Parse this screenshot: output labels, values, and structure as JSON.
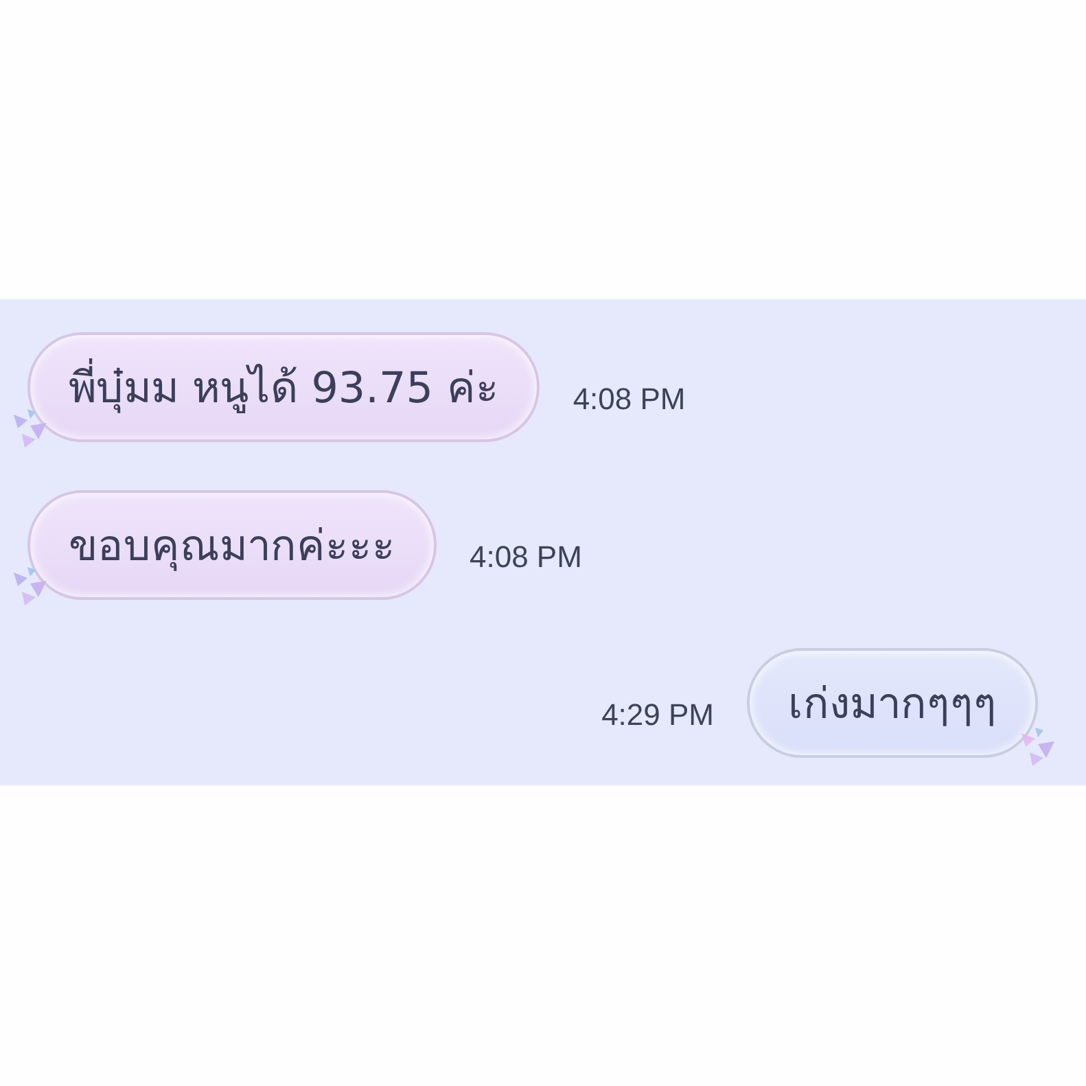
{
  "messages": [
    {
      "kind": "incoming",
      "text": "พี่บุ๋มม หนูได้ 93.75 ค่ะ",
      "time": "4:08 PM"
    },
    {
      "kind": "incoming",
      "text": "ขอบคุณมากค่ะะะ",
      "time": "4:08 PM"
    },
    {
      "kind": "outgoing",
      "text": "เก่งมากๆๆๆ",
      "time": "4:29 PM"
    }
  ]
}
